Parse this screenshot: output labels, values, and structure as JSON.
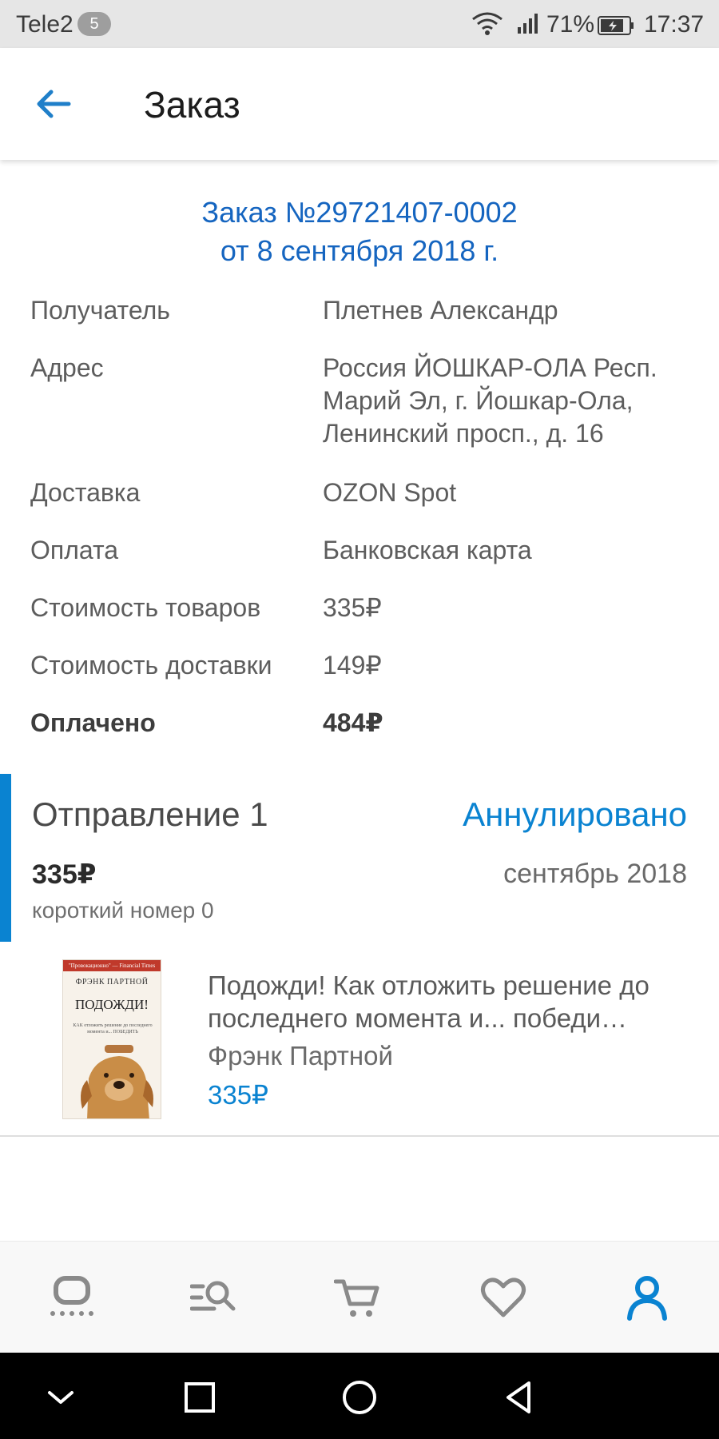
{
  "status_bar": {
    "carrier": "Tele2",
    "badge_count": "5",
    "battery_percent": "71%",
    "time": "17:37"
  },
  "app_bar": {
    "title": "Заказ",
    "back_icon": "arrow-left-icon"
  },
  "order": {
    "number_line": "Заказ №29721407-0002",
    "date_line": "от 8 сентября 2018 г.",
    "details": [
      {
        "label": "Получатель",
        "value": "Плетнев Александр"
      },
      {
        "label": "Адрес",
        "value_lines": [
          "Россия ЙОШКАР-ОЛА Респ.",
          "Марий Эл, г. Йошкар-Ола,",
          "Ленинский просп., д. 16"
        ]
      },
      {
        "label": "Доставка",
        "value": "OZON Spot"
      },
      {
        "label": "Оплата",
        "value": "Банковская карта"
      },
      {
        "label": "Стоимость товаров",
        "value": "335₽"
      },
      {
        "label": "Стоимость доставки",
        "value": "149₽"
      },
      {
        "label": "Оплачено",
        "value": "484₽"
      }
    ]
  },
  "shipment": {
    "title": "Отправление 1",
    "status": "Аннулировано",
    "price": "335₽",
    "date": "сентябрь 2018",
    "short_number": "короткий номер 0"
  },
  "product": {
    "name": "Подожди!  Как отложить решение до последнего момента и... победи…",
    "author": "Фрэнк Партной",
    "price": "335₽",
    "cover": {
      "top_strip": "\"Провокационно\" — Financial Times",
      "author": "ФРЭНК ПАРТНОЙ",
      "title": "ПОДОЖДИ!",
      "subtitle": "КАК отложить решение до последнего момента и... ПОБЕДИТЬ"
    }
  },
  "bottom_nav": [
    {
      "name": "home",
      "icon": "ozon-home-icon"
    },
    {
      "name": "catalog-search",
      "icon": "catalog-search-icon"
    },
    {
      "name": "cart",
      "icon": "cart-icon"
    },
    {
      "name": "favorites",
      "icon": "heart-icon"
    },
    {
      "name": "profile",
      "icon": "user-icon",
      "active": true
    }
  ],
  "colors": {
    "accent": "#0a83d1",
    "order_header": "#1565c0",
    "status_bar_bg": "#e6e6e6"
  }
}
